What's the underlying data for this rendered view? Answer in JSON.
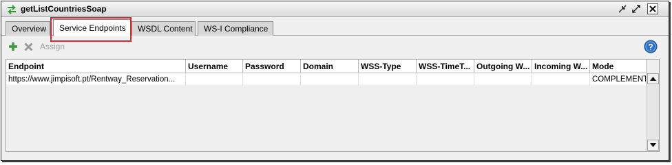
{
  "window": {
    "title": "getListCountriesSoap",
    "icon": "swap-arrows-icon"
  },
  "tabs": [
    {
      "label": "Overview",
      "active": false
    },
    {
      "label": "Service Endpoints",
      "active": true
    },
    {
      "label": "WSDL Content",
      "active": false
    },
    {
      "label": "WS-I Compliance",
      "active": false
    }
  ],
  "toolbar": {
    "add_icon": "plus-icon",
    "remove_icon": "x-icon",
    "assign_label": "Assign",
    "help_icon": "help-icon"
  },
  "grid": {
    "columns": [
      "Endpoint",
      "Username",
      "Password",
      "Domain",
      "WSS-Type",
      "WSS-TimeT...",
      "Outgoing W...",
      "Incoming W...",
      "Mode"
    ],
    "rows": [
      [
        "https://www.jimpisoft.pt/Rentway_Reservation...",
        "",
        "",
        "",
        "",
        "",
        "",
        "",
        "COMPLEMENT"
      ]
    ]
  },
  "colors": {
    "highlight": "#e0262b",
    "add_green": "#3a9a3a",
    "help_blue": "#2a6fc4"
  }
}
